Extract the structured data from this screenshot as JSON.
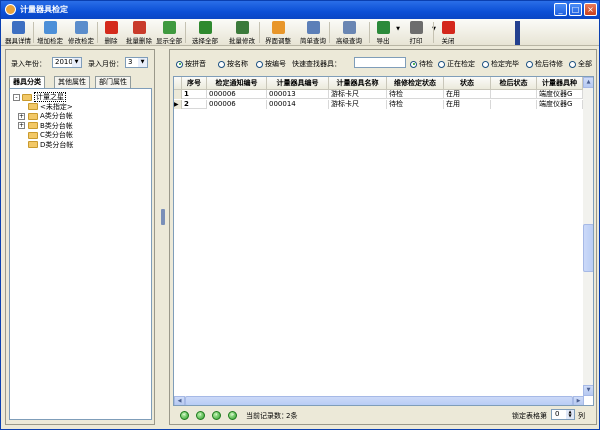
{
  "window": {
    "title": "计量器具检定",
    "min": "_",
    "max": "□",
    "close": "×"
  },
  "toolbar": {
    "buttons": [
      {
        "label": "器具详情",
        "icon": "details-icon",
        "color": "#3d6fc2"
      },
      {
        "label": "增加检定",
        "icon": "add-doc-icon",
        "color": "#4c8fd8"
      },
      {
        "label": "修改检定",
        "icon": "edit-icon",
        "color": "#5b8dcc"
      },
      {
        "label": "删除",
        "icon": "delete-x-icon",
        "color": "#d42a1c"
      },
      {
        "label": "批量删除",
        "icon": "batch-delete-icon",
        "color": "#c93b2b"
      },
      {
        "label": "显示全部",
        "icon": "show-all-icon",
        "color": "#3f9a3f"
      },
      {
        "label": "选择全部",
        "icon": "select-all-icon",
        "color": "#2f8a2f"
      },
      {
        "label": "批量修改",
        "icon": "batch-edit-icon",
        "color": "#3b7a3b"
      },
      {
        "label": "界面调整",
        "icon": "layout-icon",
        "color": "#e8962a"
      },
      {
        "label": "简单查询",
        "icon": "search-icon",
        "color": "#5c7fb8"
      },
      {
        "label": "高级查询",
        "icon": "advanced-search-icon",
        "color": "#6a86b3"
      },
      {
        "label": "导出",
        "icon": "excel-icon",
        "color": "#2b8a3a"
      },
      {
        "label": "打印",
        "icon": "printer-icon",
        "color": "#6d6d6d"
      },
      {
        "label": "关闭",
        "icon": "close-icon",
        "color": "#d4271c"
      }
    ]
  },
  "filters": {
    "year_label": "录入年份：",
    "year_value": "2010",
    "month_label": "录入月份：",
    "month_value": "3"
  },
  "tabs": [
    "器具分类",
    "其他属性",
    "部门属性"
  ],
  "tree": [
    {
      "label": "计量之星",
      "level": 0,
      "toggle": "-"
    },
    {
      "label": "<未指定>",
      "level": 1,
      "toggle": ""
    },
    {
      "label": "A类分台帐",
      "level": 1,
      "toggle": "+"
    },
    {
      "label": "B类分台帐",
      "level": 1,
      "toggle": "+"
    },
    {
      "label": "C类分台帐",
      "level": 1,
      "toggle": ""
    },
    {
      "label": "D类分台帐",
      "level": 1,
      "toggle": ""
    }
  ],
  "search_bar": {
    "sort_options": [
      "按拼音",
      "按名称",
      "按编号"
    ],
    "quick_search_label": "快速查找器具：",
    "quick_search_value": "",
    "status_options": [
      "待检",
      "正在检定",
      "检定完毕",
      "检后待修",
      "全部"
    ],
    "selected_sort": "按拼音",
    "selected_status": "待检"
  },
  "grid": {
    "columns": [
      "序号",
      "检定通知编号",
      "计量器具编号",
      "计量器具名称",
      "维修检定状态",
      "状态",
      "检后状态",
      "计量器具种"
    ],
    "rows": [
      [
        "1",
        "000006",
        "000013",
        "游标卡尺",
        "待检",
        "在用",
        "",
        "端度仪器G"
      ],
      [
        "2",
        "000006",
        "000014",
        "游标卡尺",
        "待检",
        "在用",
        "",
        "端度仪器G"
      ]
    ]
  },
  "footer": {
    "record_label": "当前记录数：",
    "record_value": "2条",
    "lock_label": "锁定表格第",
    "lock_value": "0",
    "lock_unit": "列"
  }
}
